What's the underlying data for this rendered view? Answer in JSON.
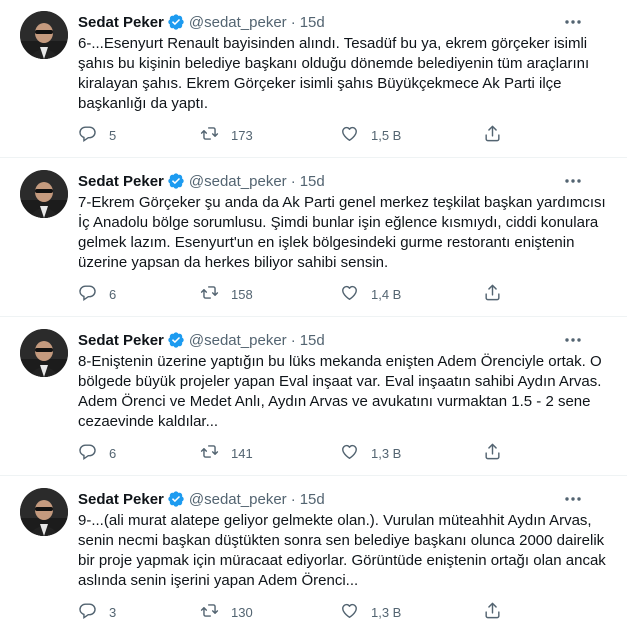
{
  "tweets": [
    {
      "name": "Sedat Peker",
      "handle": "@sedat_peker",
      "separator": "·",
      "time": "15d",
      "text": "6-...Esenyurt Renault bayisinden alındı. Tesadüf bu ya, ekrem görçeker isimli şahıs bu kişinin belediye başkanı olduğu dönemde belediyenin tüm araçlarını kiralayan şahıs. Ekrem Görçeker isimli şahıs Büyükçekmece Ak Parti ilçe başkanlığı da yaptı.",
      "replies": "5",
      "retweets": "173",
      "likes": "1,5 B"
    },
    {
      "name": "Sedat Peker",
      "handle": "@sedat_peker",
      "separator": "·",
      "time": "15d",
      "text": "7-Ekrem Görçeker şu anda da Ak Parti genel merkez teşkilat başkan yardımcısı İç Anadolu bölge sorumlusu. Şimdi bunlar işin eğlence kısmıydı, ciddi konulara gelmek lazım. Esenyurt'un en işlek bölgesindeki gurme restorantı eniştenin üzerine yapsan da herkes biliyor sahibi sensin.",
      "replies": "6",
      "retweets": "158",
      "likes": "1,4 B"
    },
    {
      "name": "Sedat Peker",
      "handle": "@sedat_peker",
      "separator": "·",
      "time": "15d",
      "text": "8-Eniştenin üzerine yaptığın bu lüks mekanda enişten Adem Örenciyle ortak. O bölgede büyük projeler yapan Eval inşaat var. Eval inşaatın sahibi Aydın Arvas. Adem Örenci ve Medet Anlı, Aydın Arvas ve avukatını vurmaktan 1.5 - 2 sene cezaevinde kaldılar...",
      "replies": "6",
      "retweets": "141",
      "likes": "1,3 B"
    },
    {
      "name": "Sedat Peker",
      "handle": "@sedat_peker",
      "separator": "·",
      "time": "15d",
      "text": "9-...(ali murat alatepe geliyor gelmekte olan.). Vurulan müteahhit Aydın Arvas, senin necmi başkan düştükten sonra sen belediye başkanı olunca 2000 dairelik bir proje yapmak için müracaat ediyorlar. Görüntüde eniştenin ortağı olan ancak aslında senin işerini yapan Adem Örenci...",
      "replies": "3",
      "retweets": "130",
      "likes": "1,3 B"
    }
  ],
  "colors": {
    "text": "#0f1419",
    "secondary": "#536471",
    "verified": "#1d9bf0",
    "divider": "#eff3f4"
  },
  "icons": {
    "verified": "verified-badge-icon",
    "more": "more-dots-icon",
    "reply": "reply-bubble-icon",
    "retweet": "retweet-arrows-icon",
    "like": "heart-icon",
    "share": "share-upload-icon"
  }
}
